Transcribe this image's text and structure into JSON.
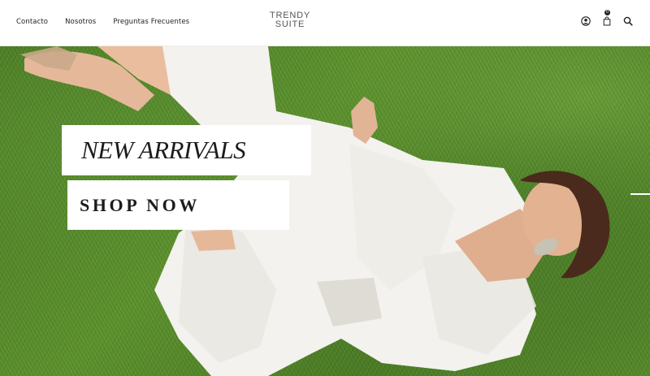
{
  "nav": {
    "items": [
      {
        "label": "Contacto"
      },
      {
        "label": "Nosotros"
      },
      {
        "label": "Preguntas Frecuentes"
      }
    ]
  },
  "logo": {
    "line1": "TRENDY",
    "line2": "SUITE"
  },
  "header_icons": {
    "account": "user-icon",
    "cart": "bag-icon",
    "cart_count": "0",
    "search": "search-icon"
  },
  "hero": {
    "headline": "NEW ARRIVALS",
    "cta_label": "SHOP NOW",
    "image_description": ""
  },
  "colors": {
    "text_dark": "#1c1c1c",
    "grass": "#5a8c2e",
    "white": "#ffffff"
  }
}
